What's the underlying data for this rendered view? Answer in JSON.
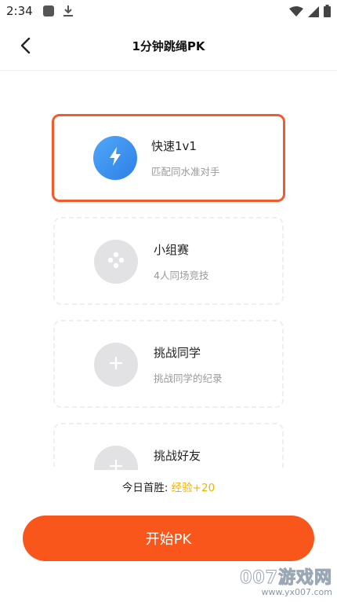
{
  "status_bar": {
    "time": "2:34"
  },
  "header": {
    "back_icon": "chevron-left-icon",
    "title": "1分钟跳绳PK"
  },
  "modes": [
    {
      "title": "快速1v1",
      "subtitle": "匹配同水准对手",
      "icon": "lightning-icon",
      "selected": true
    },
    {
      "title": "小组赛",
      "subtitle": "4人同场竞技",
      "icon": "gamepad-icon",
      "selected": false
    },
    {
      "title": "挑战同学",
      "subtitle": "挑战同学的纪录",
      "icon": "plus-icon",
      "selected": false
    },
    {
      "title": "挑战好友",
      "subtitle": "",
      "icon": "plus-icon",
      "selected": false
    }
  ],
  "reward": {
    "label": "今日首胜: ",
    "value": "经验+20"
  },
  "start_button": "开始PK",
  "watermark": {
    "brand": "007游戏网",
    "url": "www.yx007.com"
  },
  "colors": {
    "accent": "#f8561b",
    "selected_border": "#f45a2c",
    "reward_highlight": "#f0b400",
    "selected_icon_bg": "#3d92ef"
  }
}
